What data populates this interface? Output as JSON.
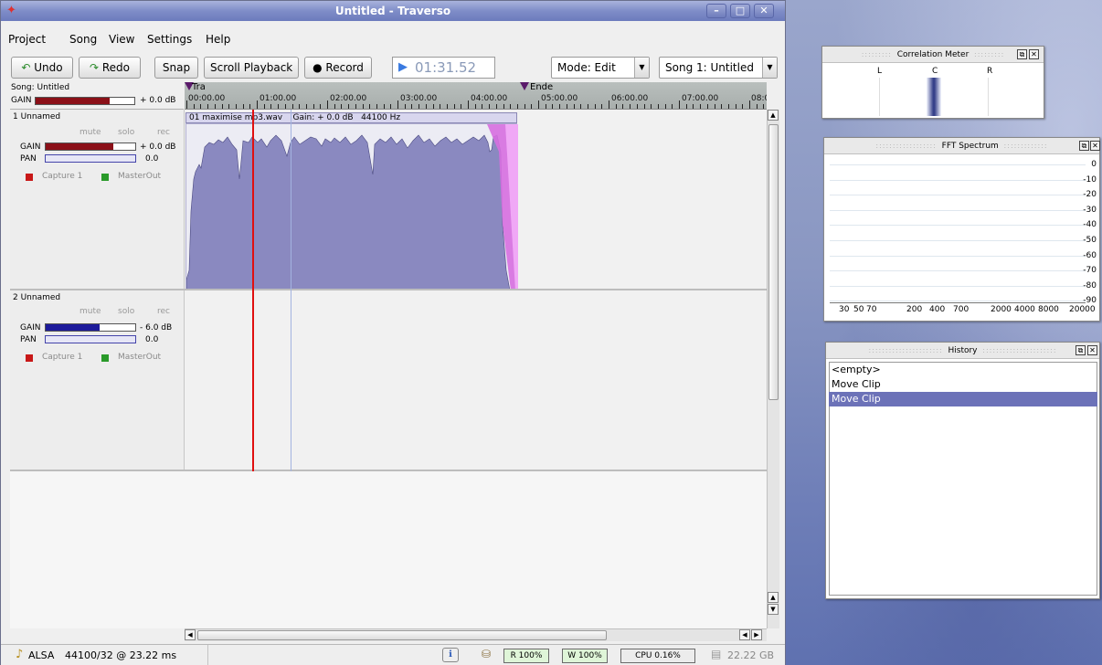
{
  "window": {
    "title": "Untitled - Traverso"
  },
  "menu": [
    "Project",
    "Song",
    "View",
    "Settings",
    "Help"
  ],
  "toolbar": {
    "undo": "Undo",
    "redo": "Redo",
    "snap": "Snap",
    "scroll_playback": "Scroll Playback",
    "record": "Record",
    "time": "01:31.52",
    "mode": "Mode: Edit",
    "song": "Song 1: Untitled"
  },
  "song_header": {
    "title": "Song: Untitled",
    "gain_label": "GAIN",
    "gain_value": "+ 0.0 dB",
    "gain_level": 0.75
  },
  "ruler": {
    "marks": [
      "00:00.00",
      "01:00.00",
      "02:00.00",
      "03:00.00",
      "04:00.00",
      "05:00.00",
      "06:00.00",
      "07:00.00",
      "08:0"
    ],
    "marker_start": "Tra",
    "marker_end": "Ende"
  },
  "tracks": [
    {
      "name": "1 Unnamed",
      "mute": "mute",
      "solo": "solo",
      "rec": "rec",
      "gain_label": "GAIN",
      "gain_value": "+ 0.0 dB",
      "gain_level": 0.75,
      "gain_color": "#8b1018",
      "pan_label": "PAN",
      "pan_value": "0.0",
      "input": "Capture 1",
      "output": "MasterOut"
    },
    {
      "name": "2 Unnamed",
      "mute": "mute",
      "solo": "solo",
      "rec": "rec",
      "gain_label": "GAIN",
      "gain_value": "- 6.0 dB",
      "gain_level": 0.6,
      "gain_color": "#1c1a9a",
      "pan_label": "PAN",
      "pan_value": "0.0",
      "input": "Capture 1",
      "output": "MasterOut"
    }
  ],
  "clip": {
    "name": "01 maximise mp3.wav",
    "gain": "Gain: + 0.0 dB",
    "rate": "44100 Hz"
  },
  "status": {
    "driver": "ALSA",
    "audio": "44100/32 @ 23.22 ms",
    "read": "R 100%",
    "write": "W 100%",
    "cpu": "CPU 0.16%",
    "disk": "22.22 GB"
  },
  "correlation_meter": {
    "title": "Correlation Meter",
    "labels": [
      "L",
      "C",
      "R"
    ]
  },
  "fft": {
    "title": "FFT Spectrum",
    "db_labels": [
      "0",
      "-10",
      "-20",
      "-30",
      "-40",
      "-50",
      "-60",
      "-70",
      "-80",
      "-90"
    ],
    "freq_labels": [
      "30",
      "50",
      "70",
      "200",
      "400",
      "700",
      "2000",
      "4000",
      "8000",
      "20000"
    ]
  },
  "history": {
    "title": "History",
    "items": [
      "<empty>",
      "Move Clip",
      "Move Clip"
    ],
    "selected_index": 2
  },
  "colors": {
    "accent": "#6c7bbd",
    "waveform": "#8a89c0",
    "playhead": "#e01010",
    "history_selected": "#6c72b8"
  }
}
